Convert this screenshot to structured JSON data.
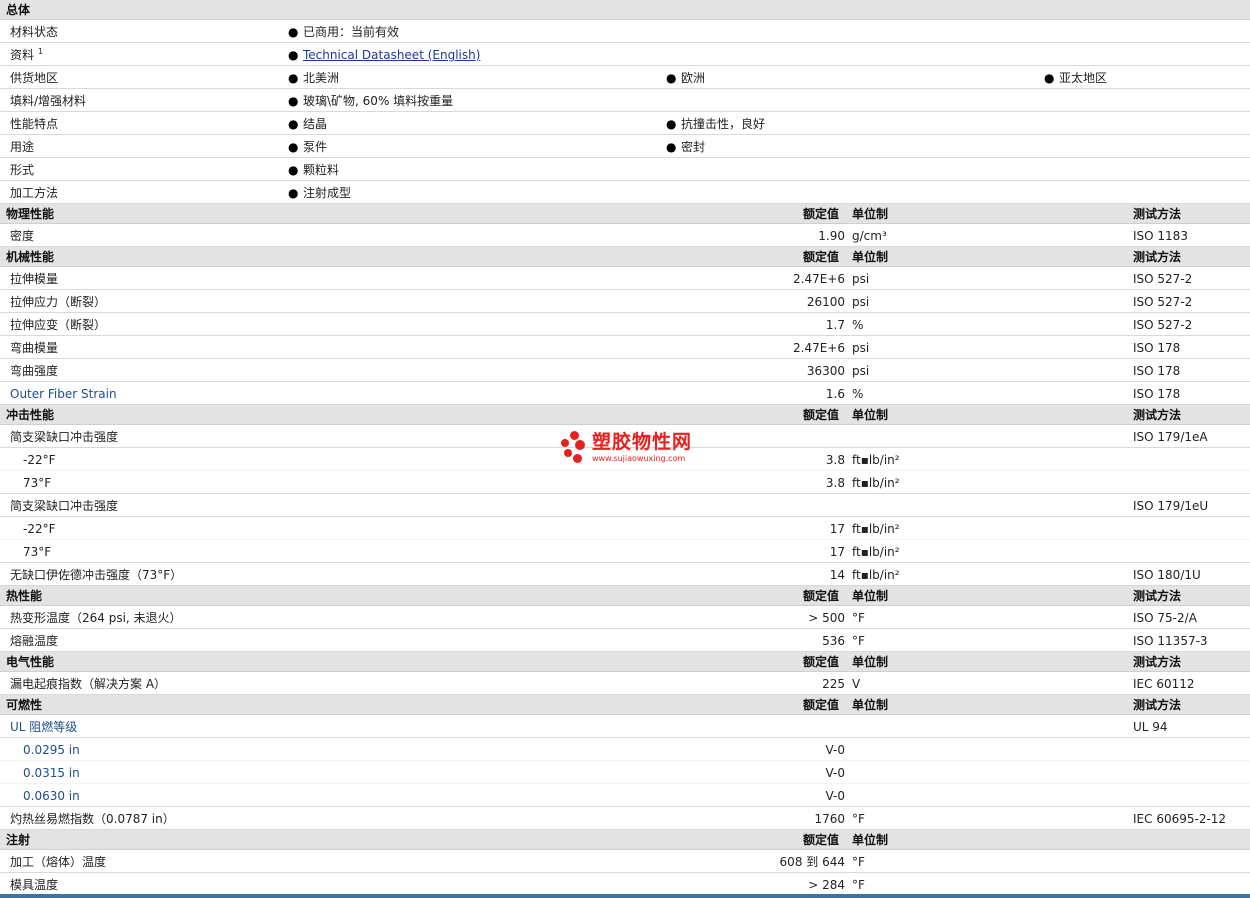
{
  "general": {
    "title": "总体",
    "rows": [
      {
        "label": "材料状态",
        "opts": [
          "已商用：当前有效"
        ]
      },
      {
        "label": "资料",
        "sup": "1",
        "link": "Technical Datasheet (English)"
      },
      {
        "label": "供货地区",
        "opts": [
          "北美洲",
          "欧洲",
          "亚太地区"
        ]
      },
      {
        "label": "填料/增强材料",
        "opts": [
          "玻璃\\矿物, 60% 填料按重量"
        ]
      },
      {
        "label": "性能特点",
        "opts": [
          "结晶",
          "抗撞击性，良好"
        ]
      },
      {
        "label": "用途",
        "opts": [
          "泵件",
          "密封"
        ]
      },
      {
        "label": "形式",
        "opts": [
          "颗粒料"
        ]
      },
      {
        "label": "加工方法",
        "opts": [
          "注射成型"
        ]
      }
    ]
  },
  "headers": {
    "value": "额定值",
    "unit": "单位制",
    "test": "测试方法"
  },
  "bullet": "●",
  "sections": [
    {
      "title": "物理性能",
      "test_header": true,
      "rows": [
        {
          "label": "密度",
          "value": "1.90",
          "unit": "g/cm³",
          "test": "ISO 1183"
        }
      ]
    },
    {
      "title": "机械性能",
      "test_header": true,
      "rows": [
        {
          "label": "拉伸模量",
          "value": "2.47E+6",
          "unit": "psi",
          "test": "ISO 527-2"
        },
        {
          "label": "拉伸应力（断裂）",
          "value": "26100",
          "unit": "psi",
          "test": "ISO 527-2"
        },
        {
          "label": "拉伸应变（断裂）",
          "value": "1.7",
          "unit": "%",
          "test": "ISO 527-2"
        },
        {
          "label": "弯曲模量",
          "value": "2.47E+6",
          "unit": "psi",
          "test": "ISO 178"
        },
        {
          "label": "弯曲强度",
          "value": "36300",
          "unit": "psi",
          "test": "ISO 178"
        },
        {
          "label": "Outer Fiber Strain",
          "value": "1.6",
          "unit": "%",
          "test": "ISO 178",
          "blue": true
        }
      ]
    },
    {
      "title": "冲击性能",
      "test_header": true,
      "rows": [
        {
          "label": "简支梁缺口冲击强度",
          "value": "",
          "unit": "",
          "test": "ISO 179/1eA"
        },
        {
          "label": "-22°F",
          "value": "3.8",
          "unit": "ft▪lb/in²",
          "test": "",
          "indent": true,
          "sub": true
        },
        {
          "label": "73°F",
          "value": "3.8",
          "unit": "ft▪lb/in²",
          "test": "",
          "indent": true
        },
        {
          "label": "简支梁缺口冲击强度",
          "value": "",
          "unit": "",
          "test": "ISO 179/1eU"
        },
        {
          "label": "-22°F",
          "value": "17",
          "unit": "ft▪lb/in²",
          "test": "",
          "indent": true,
          "sub": true
        },
        {
          "label": "73°F",
          "value": "17",
          "unit": "ft▪lb/in²",
          "test": "",
          "indent": true
        },
        {
          "label": "无缺口伊佐德冲击强度（73°F）",
          "value": "14",
          "unit": "ft▪lb/in²",
          "test": "ISO 180/1U"
        }
      ]
    },
    {
      "title": "热性能",
      "test_header": true,
      "rows": [
        {
          "label": "热变形温度（264 psi, 未退火）",
          "value": "> 500",
          "unit": "°F",
          "test": "ISO 75-2/A"
        },
        {
          "label": "熔融温度",
          "value": "536",
          "unit": "°F",
          "test": "ISO 11357-3"
        }
      ]
    },
    {
      "title": "电气性能",
      "test_header": true,
      "rows": [
        {
          "label": "漏电起痕指数（解决方案 A）",
          "value": "225",
          "unit": "V",
          "test": "IEC 60112"
        }
      ]
    },
    {
      "title": "可燃性",
      "test_header": true,
      "rows": [
        {
          "label": "UL 阻燃等级",
          "value": "",
          "unit": "",
          "test": "UL 94",
          "blue": true
        },
        {
          "label": "0.0295 in",
          "value": "V-0",
          "unit": "",
          "test": "",
          "indent": true,
          "blue": true,
          "sub": true
        },
        {
          "label": "0.0315 in",
          "value": "V-0",
          "unit": "",
          "test": "",
          "indent": true,
          "blue": true,
          "sub": true
        },
        {
          "label": "0.0630 in",
          "value": "V-0",
          "unit": "",
          "test": "",
          "indent": true,
          "blue": true
        },
        {
          "label": "灼热丝易燃指数（0.0787 in）",
          "value": "1760",
          "unit": "°F",
          "test": "IEC 60695-2-12"
        }
      ]
    },
    {
      "title": "注射",
      "test_header": false,
      "rows": [
        {
          "label": "加工（熔体）温度",
          "value": "608 到 644",
          "unit": "°F",
          "test": ""
        },
        {
          "label": "模具温度",
          "value": "> 284",
          "unit": "°F",
          "test": ""
        }
      ]
    }
  ],
  "watermark": {
    "name": "塑胶物性网",
    "url": "www.sujiaowuxing.com"
  },
  "colors": {
    "section_bg": "#e3e3e3",
    "link": "#1b38a8",
    "label_blue": "#1f4e8c",
    "watermark": "#e8201e",
    "bottom_bar": "#3b73a8"
  }
}
